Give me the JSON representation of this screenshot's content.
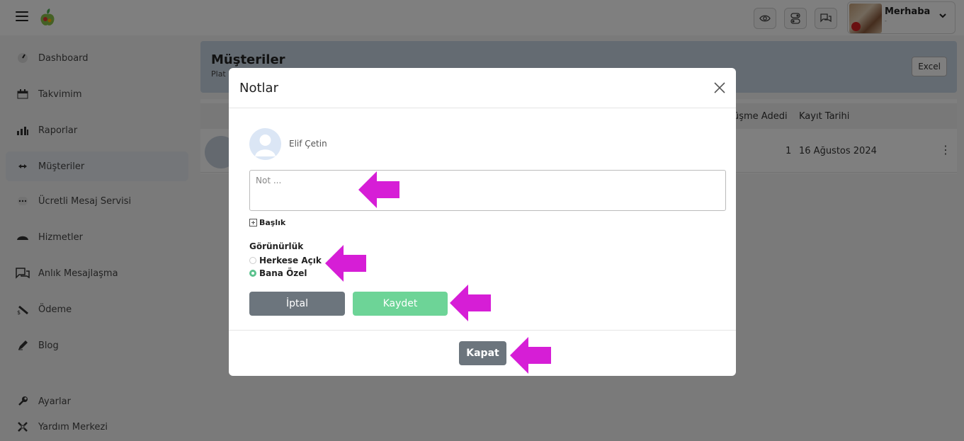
{
  "topbar": {
    "user": {
      "greeting": "Merhaba",
      "subtitle": "-"
    }
  },
  "sidebar": {
    "items": [
      {
        "label": "Dashboard",
        "icon": "dashboard-icon"
      },
      {
        "label": "Takvimim",
        "icon": "calendar-icon"
      },
      {
        "label": "Raporlar",
        "icon": "bar-chart-icon"
      },
      {
        "label": "Müşteriler",
        "icon": "customers-icon",
        "active": true
      },
      {
        "label": "Ücretli Mesaj Servisi",
        "icon": "message-dots-icon"
      },
      {
        "label": "Hizmetler",
        "icon": "service-icon"
      },
      {
        "label": "Anlık Mesajlaşma",
        "icon": "chat-icon"
      },
      {
        "label": "Ödeme",
        "icon": "payment-icon"
      },
      {
        "label": "Blog",
        "icon": "blog-pen-icon"
      }
    ],
    "bottom_items": [
      {
        "label": "Ayarlar",
        "icon": "settings-wrench-icon"
      },
      {
        "label": "Yardım Merkezi",
        "icon": "help-center-icon"
      }
    ]
  },
  "page": {
    "title": "Müşteriler",
    "subtitle": "Plat",
    "excel_label": "Excel",
    "table": {
      "headers": [
        "üşme Adedi",
        "Kayıt Tarihi"
      ],
      "row": {
        "count": "1",
        "date": "16 Ağustos 2024"
      }
    }
  },
  "modal": {
    "title": "Notlar",
    "author_name": "Elif Çetin",
    "note_placeholder": "Not ...",
    "add_title_label": "Başlık",
    "visibility_label": "Görünürlük",
    "visibility_options": [
      {
        "label": "Herkese Açık",
        "checked": false
      },
      {
        "label": "Bana Özel",
        "checked": true
      }
    ],
    "cancel_label": "İptal",
    "save_label": "Kaydet",
    "close_label": "Kapat"
  },
  "colors": {
    "accent_green": "#6dd497",
    "radio_green": "#5cc28e",
    "secondary_gray": "#6c757d",
    "annotation_arrow": "#d61ed6",
    "header_blue": "#c8d6e4"
  }
}
